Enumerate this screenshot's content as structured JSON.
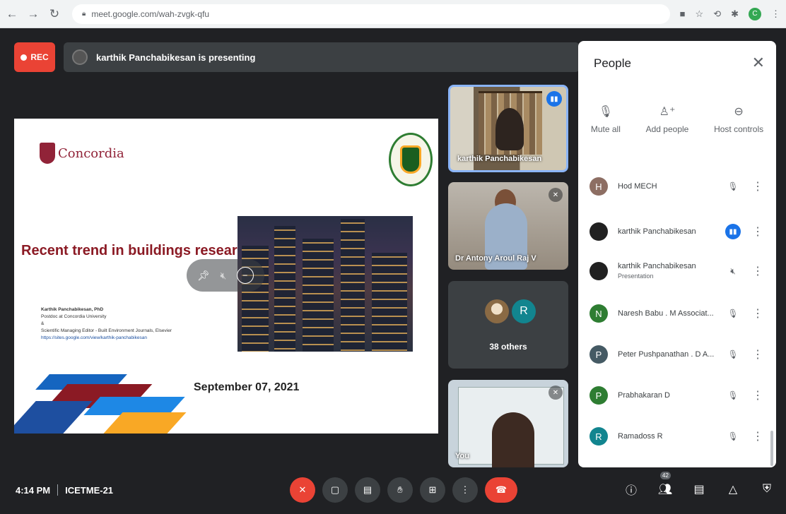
{
  "browser": {
    "url": "meet.google.com/wah-zvgk-qfu",
    "profile_initial": "C"
  },
  "banner": {
    "rec_label": "REC",
    "presenting_text": "karthik Panchabikesan is presenting"
  },
  "slide": {
    "logo_text": "Concordia",
    "title": "Recent trend in buildings research",
    "author_name": "Karthik Panchabikesan, PhD",
    "author_role": "Postdoc at Concordia University",
    "author_extra": "&",
    "author_editor": "Scientific Managing Editor - Built Environment Journals, Elsevier",
    "author_link": "https://sites.google.com/view/karthik-panchabikesan",
    "date": "September 07, 2021"
  },
  "tiles": {
    "tile1_name": "karthik Panchabikesan",
    "tile2_name": "Dr Antony Aroul Raj V",
    "tile3_others": "38 others",
    "tile3_avatar": "R",
    "tile4_name": "You"
  },
  "people": {
    "title": "People",
    "actions": [
      {
        "label": "Mute all",
        "icon": "mic-off-icon"
      },
      {
        "label": "Add people",
        "icon": "add-person-icon"
      },
      {
        "label": "Host controls",
        "icon": "toggle-icon"
      }
    ],
    "list": [
      {
        "initial": "H",
        "name": "Hod MECH",
        "sub": "",
        "color": "#8d6e63",
        "status": "muted"
      },
      {
        "initial": "",
        "name": "karthik Panchabikesan",
        "sub": "",
        "color": "#212121",
        "status": "talking"
      },
      {
        "initial": "",
        "name": "karthik Panchabikesan",
        "sub": "Presentation",
        "color": "#212121",
        "status": "sound-off"
      },
      {
        "initial": "N",
        "name": "Naresh Babu . M Associat...",
        "sub": "",
        "color": "#2e7d32",
        "status": "muted"
      },
      {
        "initial": "P",
        "name": "Peter Pushpanathan . D A...",
        "sub": "",
        "color": "#455a64",
        "status": "muted"
      },
      {
        "initial": "P",
        "name": "Prabhakaran D",
        "sub": "",
        "color": "#2e7d32",
        "status": "muted"
      },
      {
        "initial": "R",
        "name": "Ramadoss R",
        "sub": "",
        "color": "#12858f",
        "status": "muted"
      }
    ]
  },
  "bottom": {
    "time": "4:14 PM",
    "meeting_name": "ICETME-21",
    "participant_count": "42"
  },
  "colors": {
    "accent": "#1a73e8",
    "danger": "#ea4335",
    "background": "#202124",
    "surface": "#3c4043"
  }
}
